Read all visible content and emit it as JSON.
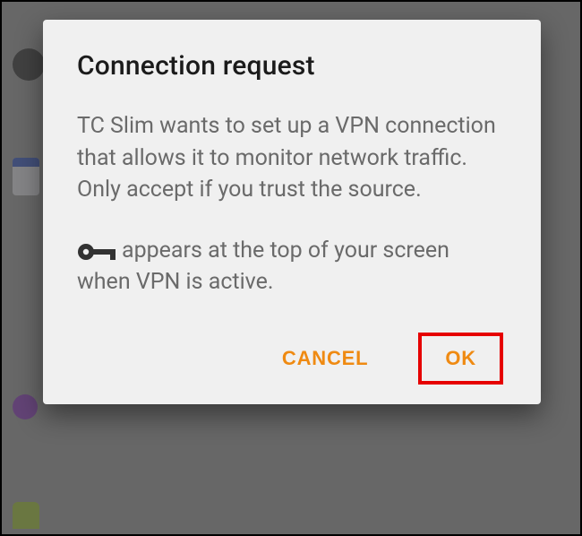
{
  "dialog": {
    "title": "Connection request",
    "body_para1": "TC Slim wants to set up a VPN connection that allows it to monitor network traffic. Only accept if you trust the source.",
    "body_para2": "appears at the top of your screen when VPN is active.",
    "icon_name": "vpn-key-icon",
    "cancel_label": "Cancel",
    "ok_label": "OK"
  },
  "colors": {
    "accent": "#ef8a12",
    "highlight_box": "#e60000"
  }
}
